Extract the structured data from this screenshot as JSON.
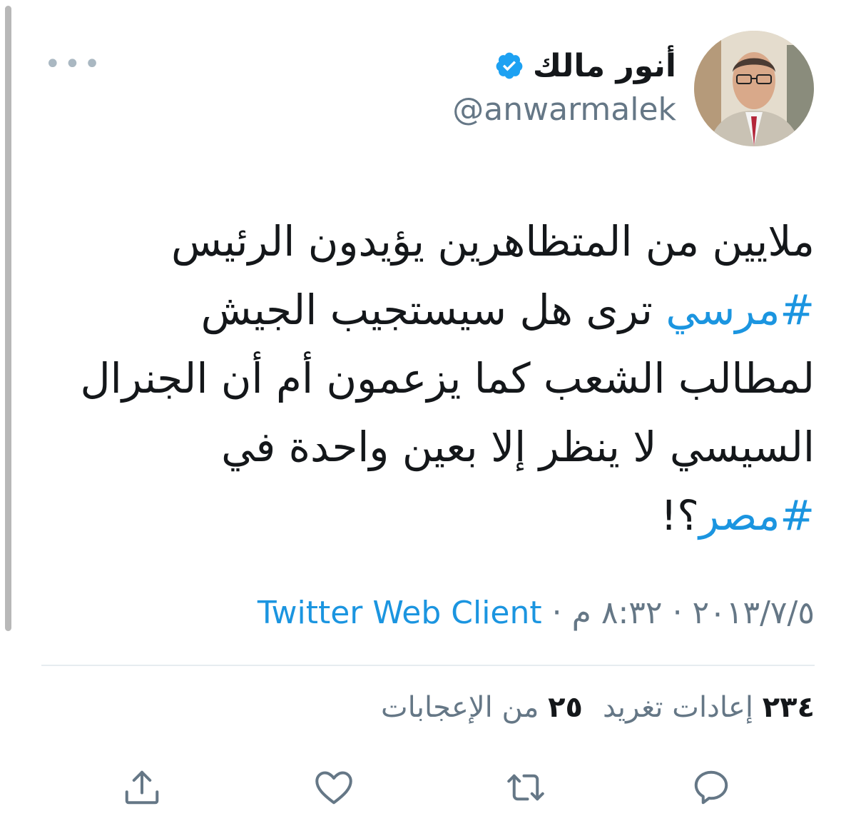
{
  "author": {
    "name": "أنور مالك",
    "handle": "@anwarmalek",
    "verified": true
  },
  "tweet": {
    "lines": [
      [
        {
          "text": "ملايين من المتظاهرين يؤيدون الرئيس",
          "hashtag": false
        }
      ],
      [
        {
          "text": "#مرسي",
          "hashtag": true
        },
        {
          "text": " ترى هل سيستجيب الجيش",
          "hashtag": false
        }
      ],
      [
        {
          "text": "لمطالب الشعب كما يزعمون أم أن الجنرال",
          "hashtag": false
        }
      ],
      [
        {
          "text": "السيسي لا ينظر إلا بعين واحدة في",
          "hashtag": false
        }
      ],
      [
        {
          "text": "#مصر",
          "hashtag": true
        },
        {
          "text": "؟!",
          "hashtag": false
        }
      ]
    ]
  },
  "meta": {
    "date": "٢٠١٣/٧/٥",
    "time": "٨:٣٢ م",
    "separator": " · ",
    "client": "Twitter Web Client"
  },
  "stats": {
    "retweets_count": "٢٣٤",
    "retweets_label": "إعادات تغريد",
    "likes_count": "٢٥",
    "likes_label": "من الإعجابات"
  },
  "icons": {
    "more": "more-icon",
    "verified": "verified-badge-icon",
    "reply": "reply-icon",
    "retweet": "retweet-icon",
    "like": "like-icon",
    "share": "share-icon"
  },
  "colors": {
    "link": "#1b95e0",
    "secondary": "#657786",
    "icon": "#657786",
    "divider": "#e6ecf0",
    "verified": "#1da1f2"
  }
}
